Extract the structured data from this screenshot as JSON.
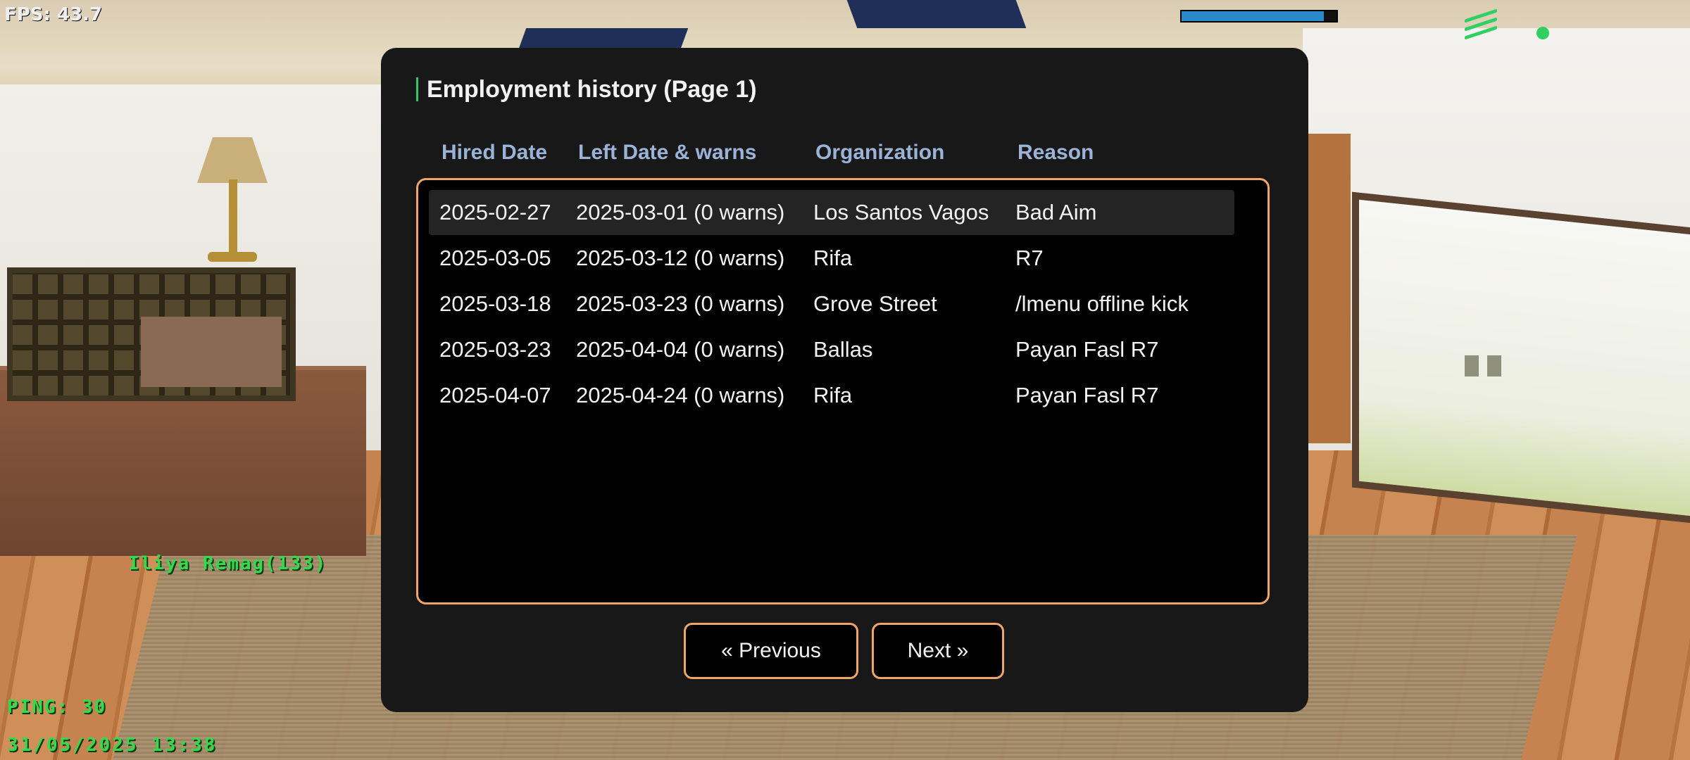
{
  "hud": {
    "fps": "FPS: 43.7",
    "health_fraction": 0.92,
    "player_name": "Iliya Remag(133)",
    "ping": "PING: 30",
    "datetime": "31/05/2025 13:38"
  },
  "dialog": {
    "title": "Employment history (Page 1)",
    "columns": [
      "Hired Date",
      "Left Date & warns",
      "Organization",
      "Reason"
    ],
    "rows": [
      [
        "2025-02-27",
        "2025-03-01 (0 warns)",
        "Los Santos Vagos",
        "Bad Aim"
      ],
      [
        "2025-03-05",
        "2025-03-12 (0 warns)",
        "Rifa",
        "R7"
      ],
      [
        "2025-03-18",
        "2025-03-23 (0 warns)",
        "Grove Street",
        "/lmenu offline kick"
      ],
      [
        "2025-03-23",
        "2025-04-04 (0 warns)",
        "Ballas",
        "Payan Fasl R7"
      ],
      [
        "2025-04-07",
        "2025-04-24 (0 warns)",
        "Rifa",
        "Payan Fasl R7"
      ]
    ],
    "previous_label": "« Previous",
    "next_label": "Next »"
  },
  "colors": {
    "accent_border": "#f0a56a",
    "title_accent": "#34c46a",
    "header_text": "#9ab3d6",
    "hud_green": "#36d94c",
    "health_blue": "#2a89c9"
  }
}
